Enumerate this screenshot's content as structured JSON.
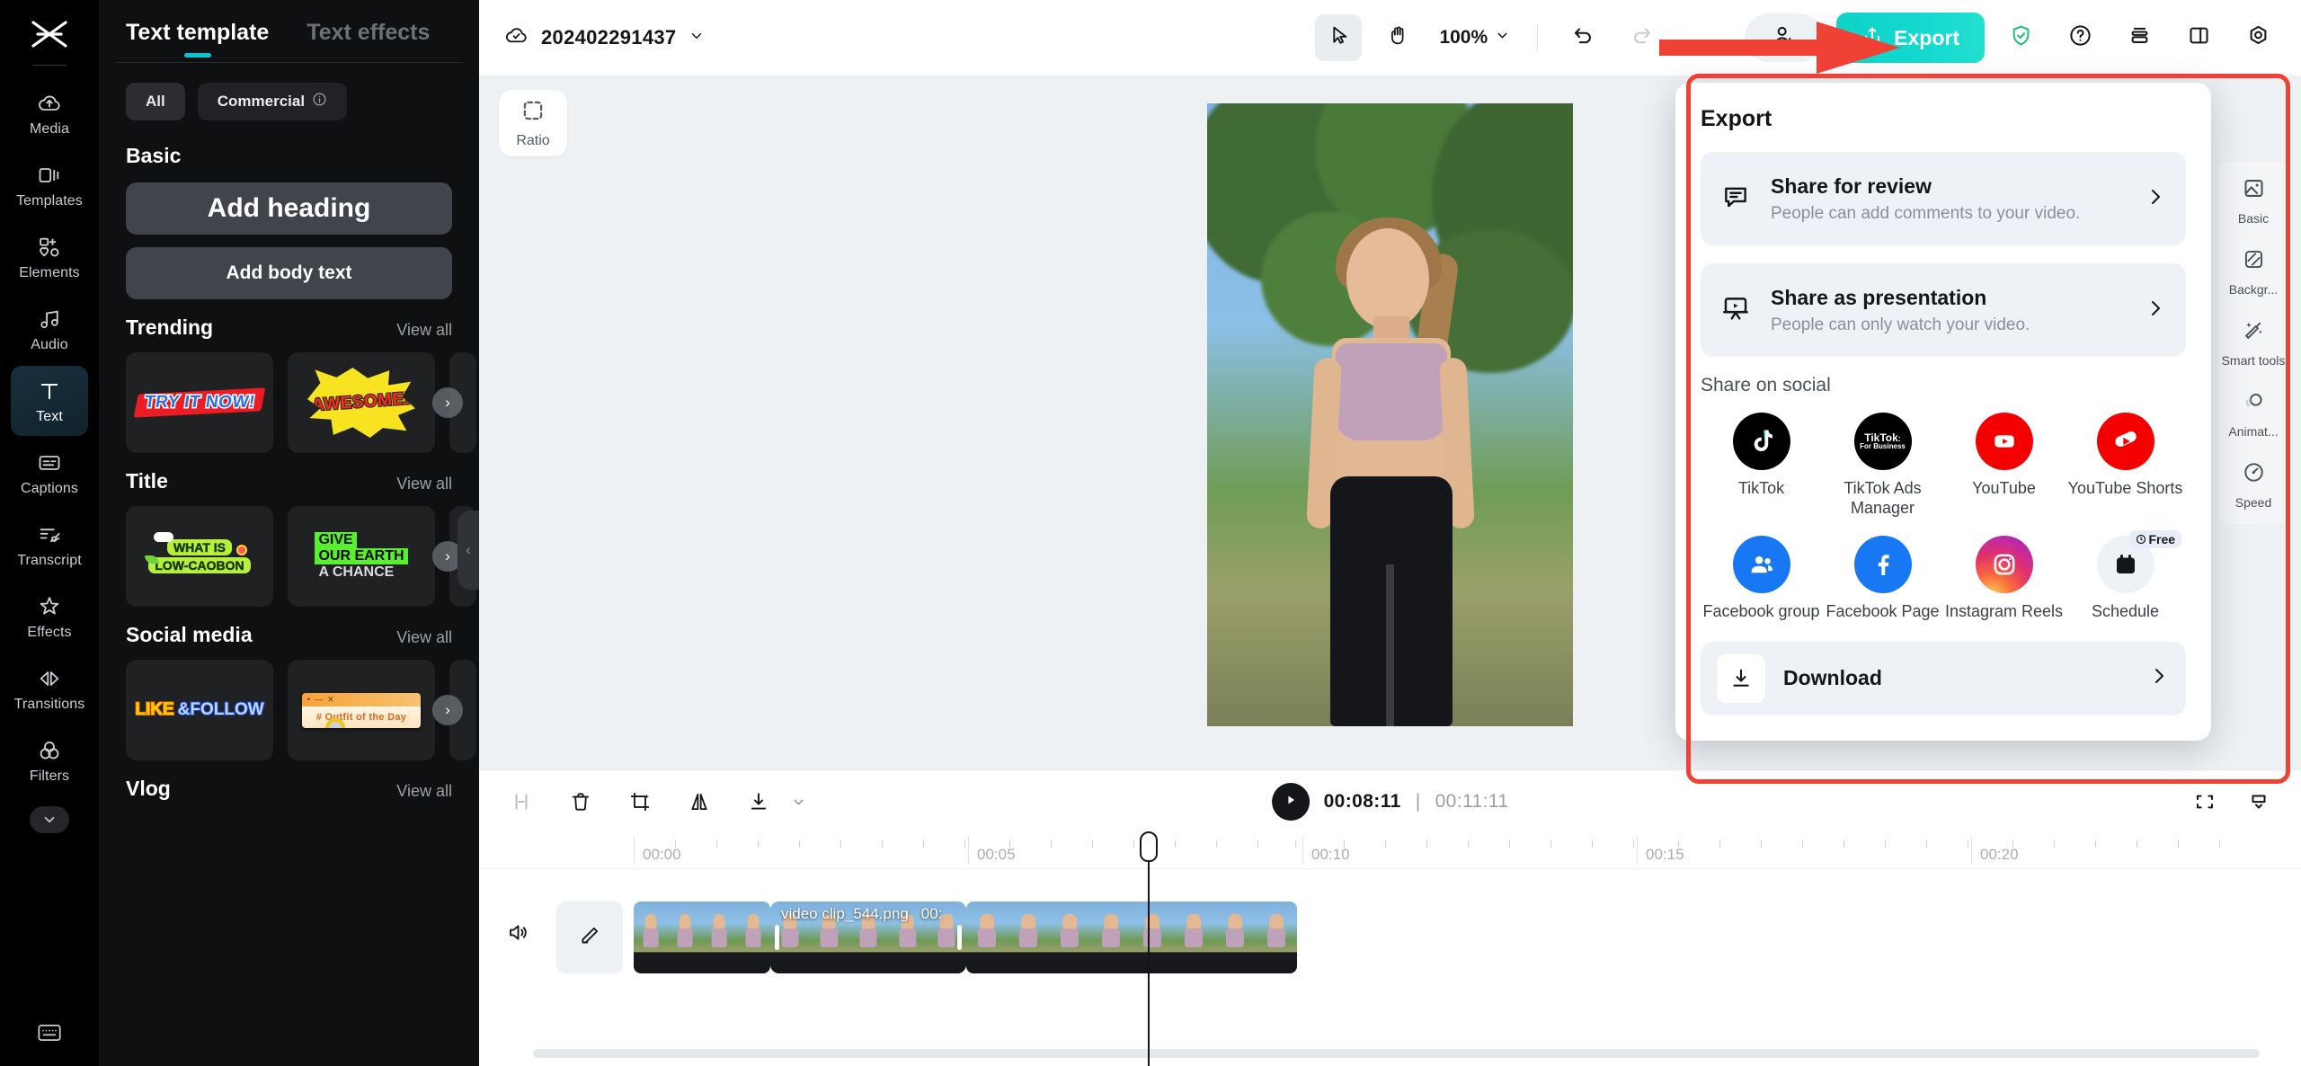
{
  "app": {
    "name": "CapCut Web Editor",
    "accent": "#00c8d7",
    "export_accent": "#15d9d0",
    "annotation_color": "#ef4136"
  },
  "rail": {
    "logo_icon": "capcut-logo-icon",
    "items": [
      {
        "label": "Media",
        "icon": "cloud-upload-icon",
        "active": false
      },
      {
        "label": "Templates",
        "icon": "templates-icon",
        "active": false
      },
      {
        "label": "Elements",
        "icon": "elements-icon",
        "active": false
      },
      {
        "label": "Audio",
        "icon": "music-note-icon",
        "active": false
      },
      {
        "label": "Text",
        "icon": "text-t-icon",
        "active": true
      },
      {
        "label": "Captions",
        "icon": "captions-icon",
        "active": false
      },
      {
        "label": "Transcript",
        "icon": "transcript-icon",
        "active": false
      },
      {
        "label": "Effects",
        "icon": "sparkle-star-icon",
        "active": false
      },
      {
        "label": "Transitions",
        "icon": "transitions-icon",
        "active": false
      },
      {
        "label": "Filters",
        "icon": "filters-circles-icon",
        "active": false
      }
    ],
    "more_icon": "chevron-down-icon",
    "bottom_icon": "keyboard-icon"
  },
  "panel": {
    "tabs": [
      {
        "label": "Text template",
        "active": true
      },
      {
        "label": "Text effects",
        "active": false
      }
    ],
    "chips": [
      {
        "label": "All",
        "selected": true
      },
      {
        "label": "Commercial",
        "selected": false,
        "info_icon": "info-circle-icon"
      }
    ],
    "collapse_icon": "chevron-left-icon",
    "sections": [
      {
        "title": "Basic",
        "view_all": "",
        "buttons": [
          {
            "label": "Add heading",
            "style": "heading"
          },
          {
            "label": "Add body text",
            "style": "body"
          }
        ]
      },
      {
        "title": "Trending",
        "view_all": "View all",
        "cards": [
          {
            "kind": "try-it-now",
            "text": "TRY IT NOW!"
          },
          {
            "kind": "awesome",
            "text": "AWESOME!"
          },
          {
            "kind": "partial",
            "text": ""
          }
        ]
      },
      {
        "title": "Title",
        "view_all": "View all",
        "cards": [
          {
            "kind": "low-carbon",
            "line1": "WHAT IS",
            "line2": "LOW-CAOBON"
          },
          {
            "kind": "give-earth",
            "line1": "GIVE",
            "line2": "OUR EARTH",
            "line3": "A CHANCE"
          },
          {
            "kind": "partial",
            "text": ""
          }
        ]
      },
      {
        "title": "Social media",
        "view_all": "View all",
        "cards": [
          {
            "kind": "like-follow",
            "line1": "LIKE",
            "line2": "&FOLLOW"
          },
          {
            "kind": "outfit",
            "text": "# Outfit of the Day"
          },
          {
            "kind": "partial",
            "text": ""
          }
        ]
      },
      {
        "title": "Vlog",
        "view_all": "View all",
        "cards": []
      }
    ],
    "row_arrow_icon": "chevron-right-icon"
  },
  "topbar": {
    "cloud_icon": "cloud-check-icon",
    "project_name": "202402291437",
    "project_dropdown_icon": "chevron-down-icon",
    "tools": [
      {
        "name": "select-cursor",
        "icon": "cursor-arrow-icon",
        "active": true
      },
      {
        "name": "hand-pan",
        "icon": "hand-icon",
        "active": false
      }
    ],
    "zoom_level": "100%",
    "zoom_dropdown_icon": "chevron-down-icon",
    "undo_icon": "undo-arrow-icon",
    "redo_icon": "redo-arrow-icon",
    "collaborate_icon": "person-add-icon",
    "export_label": "Export",
    "export_icon": "upload-share-icon",
    "right_icons": [
      {
        "name": "shield-check-icon"
      },
      {
        "name": "help-question-icon"
      },
      {
        "name": "layers-stack-icon"
      },
      {
        "name": "split-layout-icon"
      },
      {
        "name": "settings-gear-icon"
      }
    ]
  },
  "stage": {
    "ratio_label": "Ratio",
    "ratio_icon": "crop-dashed-icon"
  },
  "toolstrip": {
    "items": [
      {
        "label": "Basic",
        "icon": "image-basic-icon"
      },
      {
        "label": "Backgr...",
        "icon": "background-hatch-icon"
      },
      {
        "label": "Smart tools",
        "icon": "magic-wand-icon"
      },
      {
        "label": "Animat...",
        "icon": "animation-circles-icon"
      },
      {
        "label": "Speed",
        "icon": "speedometer-icon"
      }
    ]
  },
  "timeline": {
    "tools": [
      {
        "name": "split-icon"
      },
      {
        "name": "delete-trash-icon"
      },
      {
        "name": "crop-magic-icon"
      },
      {
        "name": "mirror-flip-icon"
      },
      {
        "name": "download-icon"
      },
      {
        "name": "chevron-down-icon"
      }
    ],
    "play_icon": "play-triangle-icon",
    "current_time": "00:08:11",
    "separator": "|",
    "total_duration": "00:11:11",
    "right_icons": [
      {
        "name": "fit-screen-icon"
      },
      {
        "name": "track-height-icon"
      }
    ],
    "ruler_labels": [
      "00:00",
      "00:05",
      "00:10",
      "00:15",
      "00:20"
    ],
    "track": {
      "audio_icon": "speaker-volume-icon",
      "edit_icon": "pencil-edit-icon",
      "clips": [
        {
          "name": "",
          "selected": false
        },
        {
          "name": "video clip_544.png",
          "time": "00:",
          "selected": true
        },
        {
          "name": "",
          "selected": false
        }
      ]
    }
  },
  "export_panel": {
    "title": "Export",
    "rows": [
      {
        "title": "Share for review",
        "subtitle": "People can add comments to your video.",
        "icon": "comment-bubble-icon",
        "chevron": "chevron-right-icon"
      },
      {
        "title": "Share as presentation",
        "subtitle": "People can only watch your video.",
        "icon": "presentation-screen-icon",
        "chevron": "chevron-right-icon"
      }
    ],
    "social_heading": "Share on social",
    "socials": [
      {
        "label": "TikTok",
        "icon": "tiktok-icon",
        "badge": ""
      },
      {
        "label": "TikTok Ads Manager",
        "icon": "tiktok-ads-manager-icon",
        "badge": ""
      },
      {
        "label": "YouTube",
        "icon": "youtube-icon",
        "badge": ""
      },
      {
        "label": "YouTube Shorts",
        "icon": "youtube-shorts-icon",
        "badge": ""
      },
      {
        "label": "Facebook group",
        "icon": "facebook-group-icon",
        "badge": ""
      },
      {
        "label": "Facebook Page",
        "icon": "facebook-page-icon",
        "badge": ""
      },
      {
        "label": "Instagram Reels",
        "icon": "instagram-reels-icon",
        "badge": ""
      },
      {
        "label": "Schedule",
        "icon": "calendar-schedule-icon",
        "badge": "Free"
      }
    ],
    "download": {
      "label": "Download",
      "icon": "download-tray-icon",
      "chevron": "chevron-right-icon"
    }
  }
}
